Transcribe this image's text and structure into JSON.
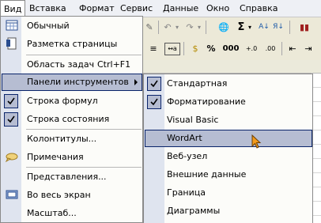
{
  "menubar": [
    {
      "label": "Вид",
      "active": true
    },
    {
      "label": "Вставка"
    },
    {
      "label": "Формат"
    },
    {
      "label": "Сервис"
    },
    {
      "label": "Данные"
    },
    {
      "label": "Окно"
    },
    {
      "label": "Справка"
    }
  ],
  "toolbar": {
    "sigma": "Σ",
    "percent": "%",
    "thousands": "000"
  },
  "menu": {
    "items": [
      {
        "label": "Обычный",
        "icon": "normal-view-icon"
      },
      {
        "label": "Разметка страницы",
        "icon": "page-layout-icon"
      },
      {
        "label": "Область задач",
        "shortcut": "Ctrl+F1"
      },
      {
        "label": "Панели инструментов",
        "submenu": true,
        "highlighted": true
      },
      {
        "label": "Строка формул",
        "checked": true
      },
      {
        "label": "Строка состояния",
        "checked": true
      },
      {
        "label": "Колонтитулы..."
      },
      {
        "label": "Примечания",
        "icon": "comments-icon"
      },
      {
        "label": "Представления..."
      },
      {
        "label": "Во весь экран",
        "icon": "full-screen-icon"
      },
      {
        "label": "Масштаб..."
      }
    ]
  },
  "submenu": {
    "items": [
      {
        "label": "Стандартная",
        "checked": true
      },
      {
        "label": "Форматирование",
        "checked": true
      },
      {
        "label": "Visual Basic"
      },
      {
        "label": "WordArt",
        "highlighted": true
      },
      {
        "label": "Веб-узел"
      },
      {
        "label": "Внешние данные"
      },
      {
        "label": "Граница"
      },
      {
        "label": "Диаграммы"
      }
    ]
  },
  "colors": {
    "highlight": "#b6bdd2",
    "highlight_border": "#0a246a",
    "gutter": "#dfe4ef"
  }
}
